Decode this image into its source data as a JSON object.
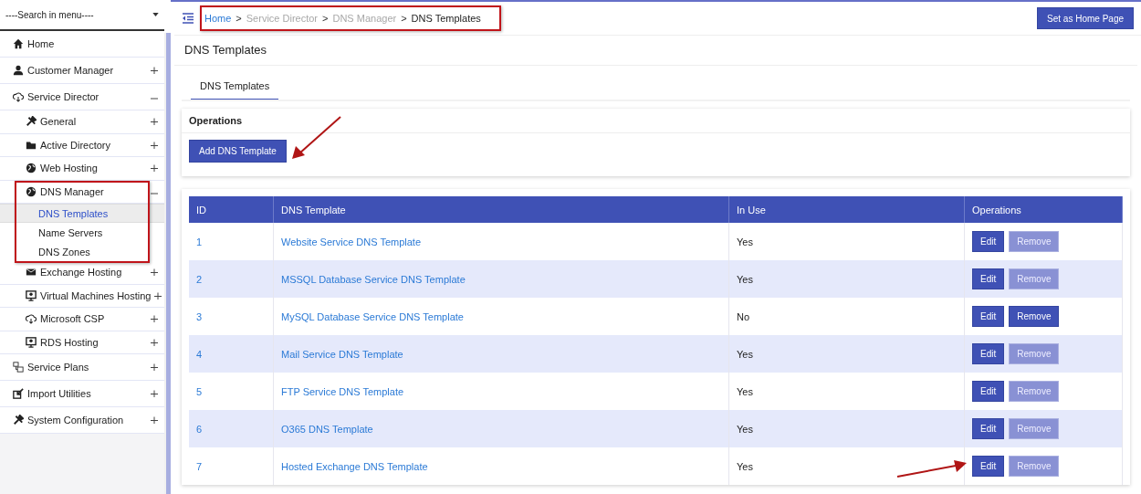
{
  "sidebar": {
    "search": {
      "placeholder": "----Search in menu----"
    },
    "items": [
      {
        "label": "Home",
        "selected": false
      },
      {
        "label": "Customer Manager",
        "selected": false,
        "expanded": false
      },
      {
        "label": "Service Director",
        "selected": false,
        "expanded": true,
        "children": [
          {
            "label": "General",
            "selected": false,
            "expanded": false
          },
          {
            "label": "Active Directory",
            "selected": false,
            "expanded": false
          },
          {
            "label": "Web Hosting",
            "selected": false,
            "expanded": false
          },
          {
            "label": "DNS Manager",
            "selected": false,
            "expanded": true,
            "highlighted": true,
            "children": [
              {
                "label": "DNS Templates",
                "selected": true
              },
              {
                "label": "Name Servers",
                "selected": false
              },
              {
                "label": "DNS Zones",
                "selected": false
              }
            ]
          },
          {
            "label": "Exchange Hosting",
            "selected": false,
            "expanded": false
          },
          {
            "label": "Virtual Machines Hosting",
            "selected": false,
            "expanded": false
          },
          {
            "label": "Microsoft CSP",
            "selected": false,
            "expanded": false
          },
          {
            "label": "RDS Hosting",
            "selected": false,
            "expanded": false
          }
        ]
      },
      {
        "label": "Service Plans",
        "selected": false,
        "expanded": false
      },
      {
        "label": "Import Utilities",
        "selected": false,
        "expanded": false
      },
      {
        "label": "System Configuration",
        "selected": false,
        "expanded": false
      }
    ]
  },
  "breadcrumb": {
    "highlighted": true,
    "items": [
      {
        "label": "Home",
        "kind": "link"
      },
      {
        "label": "Service Director",
        "kind": "muted"
      },
      {
        "label": "DNS Manager",
        "kind": "muted"
      },
      {
        "label": "DNS Templates",
        "kind": "current"
      }
    ],
    "separator": ">"
  },
  "home_button": "Set as Home Page",
  "page_title": "DNS Templates",
  "tabs": [
    {
      "label": "DNS Templates",
      "selected": true
    }
  ],
  "operations": {
    "title": "Operations",
    "button": {
      "label": "Add DNS Template",
      "annotated": true
    }
  },
  "table": {
    "columns": [
      "ID",
      "DNS Template",
      "In Use",
      "Operations"
    ],
    "rows": [
      {
        "id": "1",
        "template": "Website Service DNS Template",
        "in_use": "Yes",
        "edit": "Edit",
        "remove": "Remove",
        "remove_disabled": true,
        "annotated": false
      },
      {
        "id": "2",
        "template": "MSSQL Database Service DNS Template",
        "in_use": "Yes",
        "edit": "Edit",
        "remove": "Remove",
        "remove_disabled": true,
        "annotated": false
      },
      {
        "id": "3",
        "template": "MySQL Database Service DNS Template",
        "in_use": "No",
        "edit": "Edit",
        "remove": "Remove",
        "remove_disabled": false,
        "annotated": false
      },
      {
        "id": "4",
        "template": "Mail Service DNS Template",
        "in_use": "Yes",
        "edit": "Edit",
        "remove": "Remove",
        "remove_disabled": true,
        "annotated": false
      },
      {
        "id": "5",
        "template": "FTP Service DNS Template",
        "in_use": "Yes",
        "edit": "Edit",
        "remove": "Remove",
        "remove_disabled": true,
        "annotated": false
      },
      {
        "id": "6",
        "template": "O365 DNS Template",
        "in_use": "Yes",
        "edit": "Edit",
        "remove": "Remove",
        "remove_disabled": true,
        "annotated": false
      },
      {
        "id": "7",
        "template": "Hosted Exchange DNS Template",
        "in_use": "Yes",
        "edit": "Edit",
        "remove": "Remove",
        "remove_disabled": true,
        "annotated": true
      }
    ]
  }
}
